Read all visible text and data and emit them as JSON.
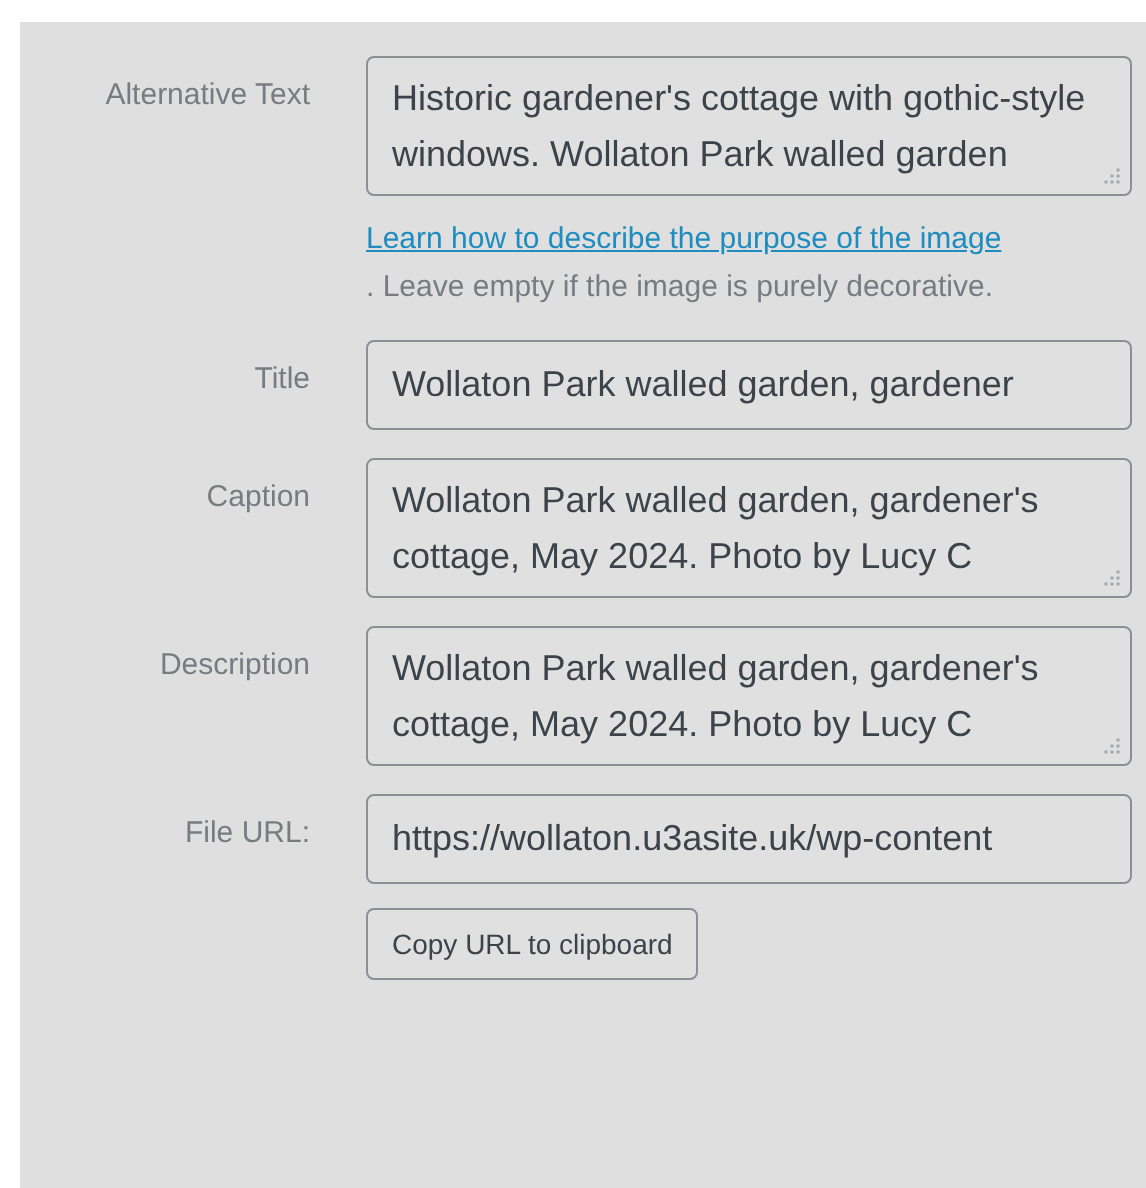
{
  "fields": [
    {
      "kind": "textarea",
      "label": "Alternative Text",
      "value": "Historic gardener's cottage with gothic-style windows. Wollaton Park walled garden",
      "help_link": "Learn how to describe the purpose of the image",
      "help_text": ". Leave empty if the image is purely decorative."
    },
    {
      "kind": "input",
      "label": "Title",
      "value": "Wollaton Park walled garden, gardener"
    },
    {
      "kind": "textarea",
      "label": "Caption",
      "value": "Wollaton Park walled garden, gardener's cottage, May 2024. Photo by Lucy C"
    },
    {
      "kind": "textarea",
      "label": "Description",
      "value": "Wollaton Park walled garden, gardener's cottage, May 2024. Photo by Lucy C"
    },
    {
      "kind": "input",
      "label": "File URL:",
      "value": "https://wollaton.u3asite.uk/wp-content",
      "button": "Copy URL to clipboard"
    }
  ]
}
